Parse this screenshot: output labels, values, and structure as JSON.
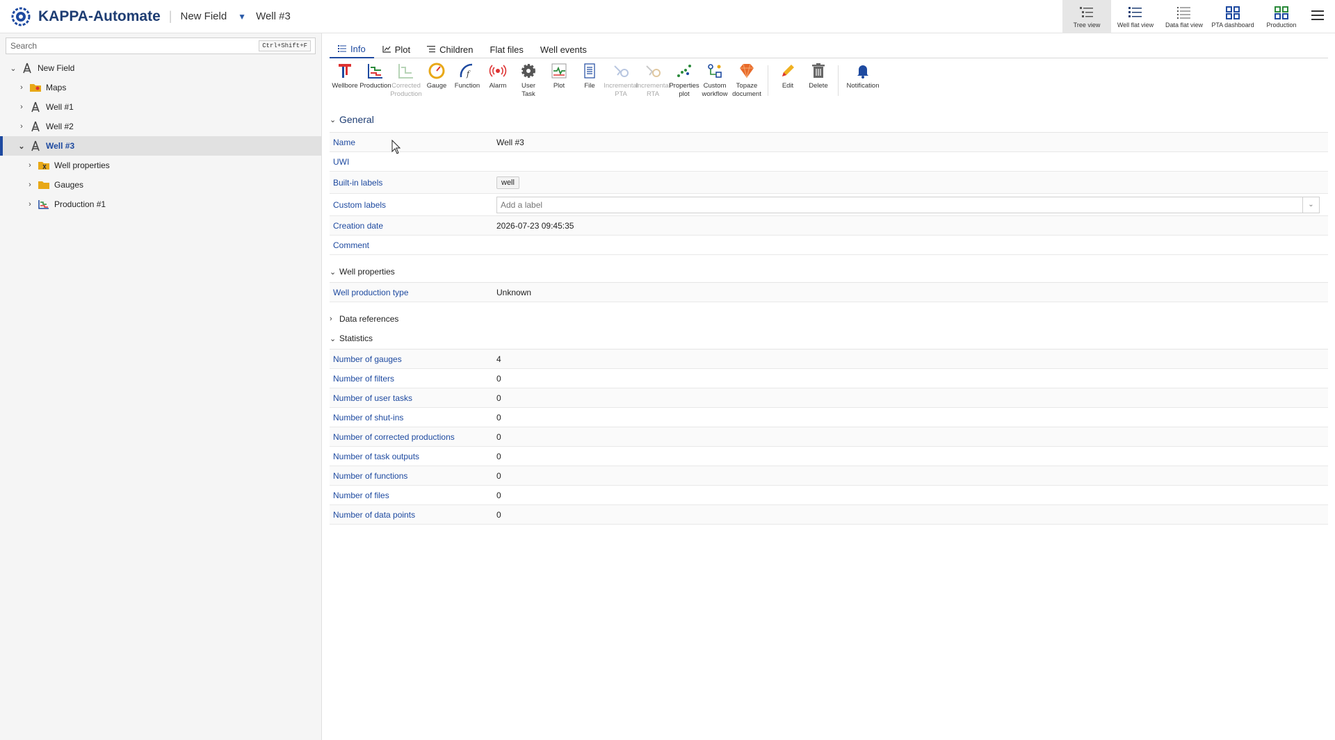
{
  "header": {
    "app_title": "KAPPA-Automate",
    "separator": "|",
    "field": "New Field",
    "well": "Well #3",
    "views": [
      {
        "label": "Tree view",
        "icon": "tree-view-icon"
      },
      {
        "label": "Well flat view",
        "icon": "well-flat-view-icon"
      },
      {
        "label": "Data flat view",
        "icon": "data-flat-view-icon"
      },
      {
        "label": "PTA dashboard",
        "icon": "pta-dashboard-icon"
      },
      {
        "label": "Production",
        "icon": "production-dashboard-icon"
      }
    ]
  },
  "sidebar": {
    "search_placeholder": "Search",
    "search_shortcut": "Ctrl+Shift+F",
    "tree": [
      {
        "label": "New Field",
        "icon": "well-rig-icon"
      },
      {
        "label": "Maps",
        "icon": "maps-folder-icon"
      },
      {
        "label": "Well #1",
        "icon": "well-rig-icon"
      },
      {
        "label": "Well #2",
        "icon": "well-rig-icon"
      },
      {
        "label": "Well #3",
        "icon": "well-rig-icon"
      },
      {
        "label": "Well properties",
        "icon": "well-properties-folder-icon"
      },
      {
        "label": "Gauges",
        "icon": "folder-icon"
      },
      {
        "label": "Production #1",
        "icon": "production-icon"
      }
    ]
  },
  "tabs": [
    {
      "label": "Info"
    },
    {
      "label": "Plot"
    },
    {
      "label": "Children"
    },
    {
      "label": "Flat files"
    },
    {
      "label": "Well events"
    }
  ],
  "toolbar": [
    {
      "l1": "Wellbore",
      "l2": ""
    },
    {
      "l1": "Production",
      "l2": ""
    },
    {
      "l1": "Corrected",
      "l2": "Production"
    },
    {
      "l1": "Gauge",
      "l2": ""
    },
    {
      "l1": "Function",
      "l2": ""
    },
    {
      "l1": "Alarm",
      "l2": ""
    },
    {
      "l1": "User",
      "l2": "Task"
    },
    {
      "l1": "Plot",
      "l2": ""
    },
    {
      "l1": "File",
      "l2": ""
    },
    {
      "l1": "Incremental",
      "l2": "PTA"
    },
    {
      "l1": "Incremental",
      "l2": "RTA"
    },
    {
      "l1": "Properties",
      "l2": "plot"
    },
    {
      "l1": "Custom",
      "l2": "workflow"
    },
    {
      "l1": "Topaze",
      "l2": "document"
    },
    {
      "l1": "Edit",
      "l2": ""
    },
    {
      "l1": "Delete",
      "l2": ""
    },
    {
      "l1": "Notification",
      "l2": ""
    }
  ],
  "general": {
    "title": "General",
    "name_label": "Name",
    "name_value": "Well #3",
    "uwi_label": "UWI",
    "uwi_value": "",
    "builtin_label": "Built-in labels",
    "builtin_value": "well",
    "custom_label": "Custom labels",
    "custom_placeholder": "Add a label",
    "creation_label": "Creation date",
    "creation_value": "2026-07-23 09:45:35",
    "comment_label": "Comment",
    "comment_value": ""
  },
  "well_properties": {
    "title": "Well properties",
    "type_label": "Well production type",
    "type_value": "Unknown"
  },
  "data_references": {
    "title": "Data references"
  },
  "statistics": {
    "title": "Statistics",
    "rows": [
      {
        "label": "Number of gauges",
        "value": "4"
      },
      {
        "label": "Number of filters",
        "value": "0"
      },
      {
        "label": "Number of user tasks",
        "value": "0"
      },
      {
        "label": "Number of shut-ins",
        "value": "0"
      },
      {
        "label": "Number of corrected productions",
        "value": "0"
      },
      {
        "label": "Number of task outputs",
        "value": "0"
      },
      {
        "label": "Number of functions",
        "value": "0"
      },
      {
        "label": "Number of files",
        "value": "0"
      },
      {
        "label": "Number of data points",
        "value": "0"
      }
    ]
  },
  "colors": {
    "accent": "#1e4aa0",
    "brand": "#1e3d73"
  }
}
